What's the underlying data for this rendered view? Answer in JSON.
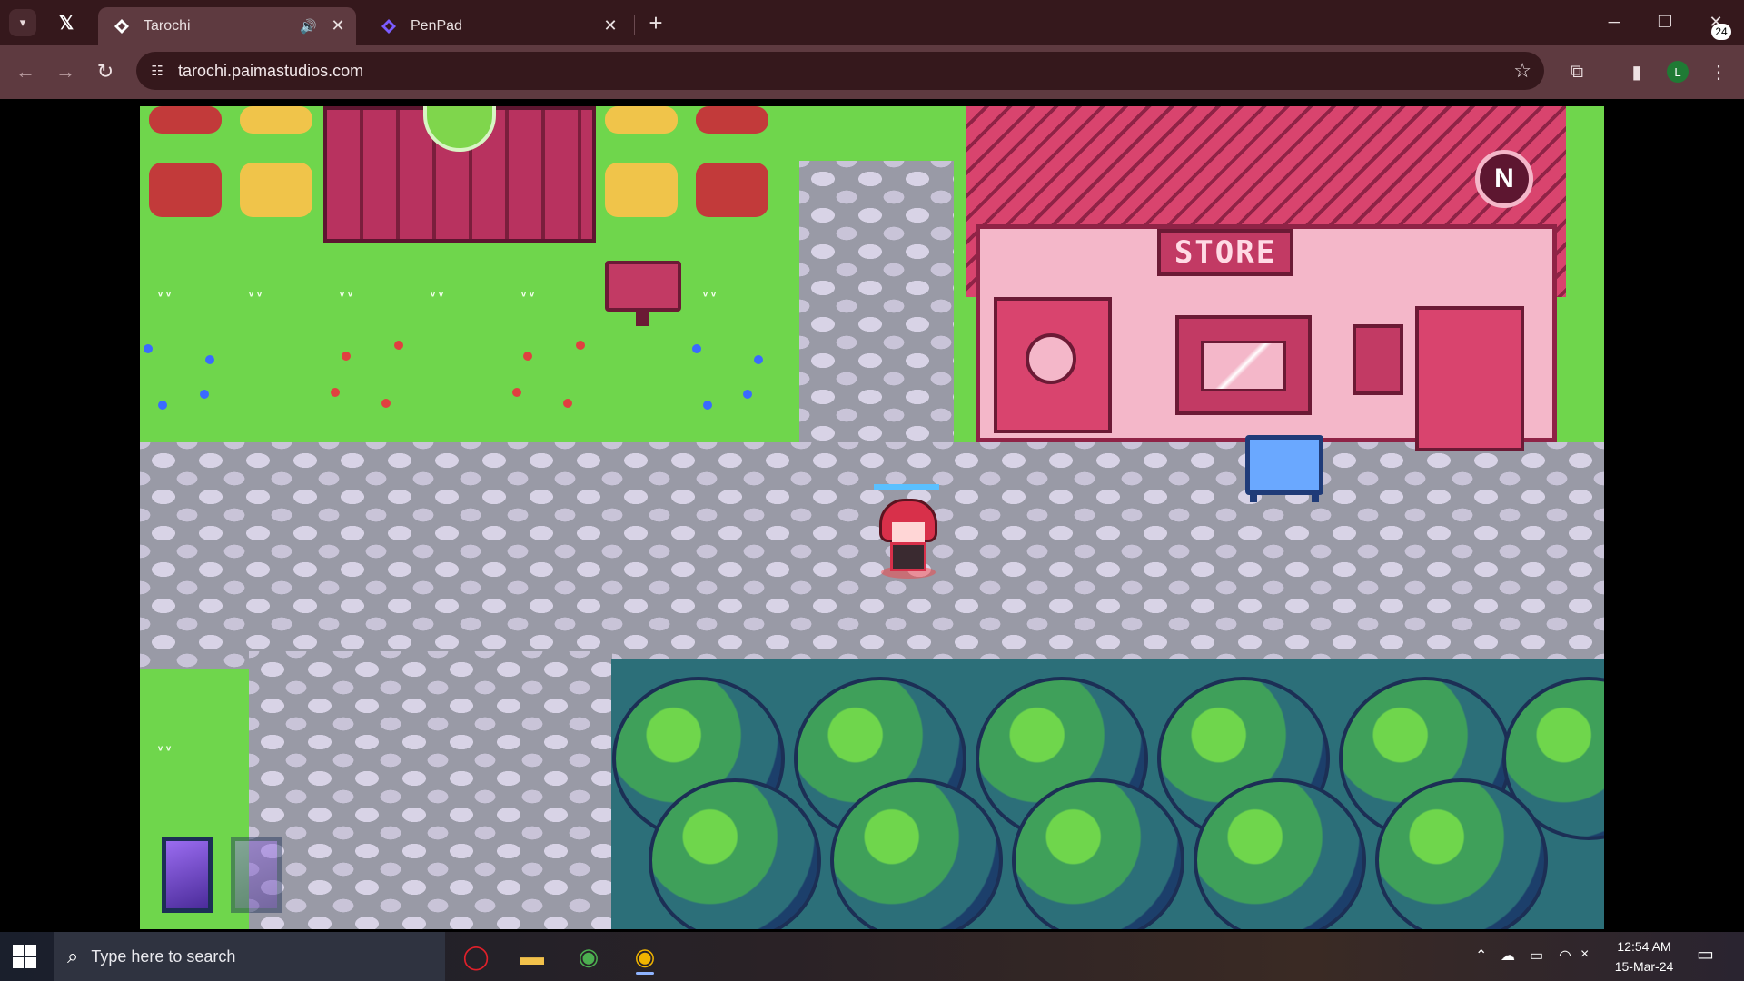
{
  "browser": {
    "tabs": [
      {
        "title": "Tarochi",
        "active": true,
        "audio": true
      },
      {
        "title": "PenPad",
        "active": false,
        "audio": false
      }
    ],
    "address": "tarochi.paimastudios.com",
    "profile_initial": "L"
  },
  "game": {
    "store_sign": "STORE",
    "store_badge": "N"
  },
  "taskbar": {
    "search_placeholder": "Type here to search",
    "time": "12:54 AM",
    "date": "15-Mar-24",
    "notification_count": "24"
  },
  "colors": {
    "tab_bar": "#35181c",
    "toolbar": "#5e3a40",
    "grass": "#6fd64c",
    "store_pink": "#d9446e",
    "water_blue": "#2c6f79"
  }
}
